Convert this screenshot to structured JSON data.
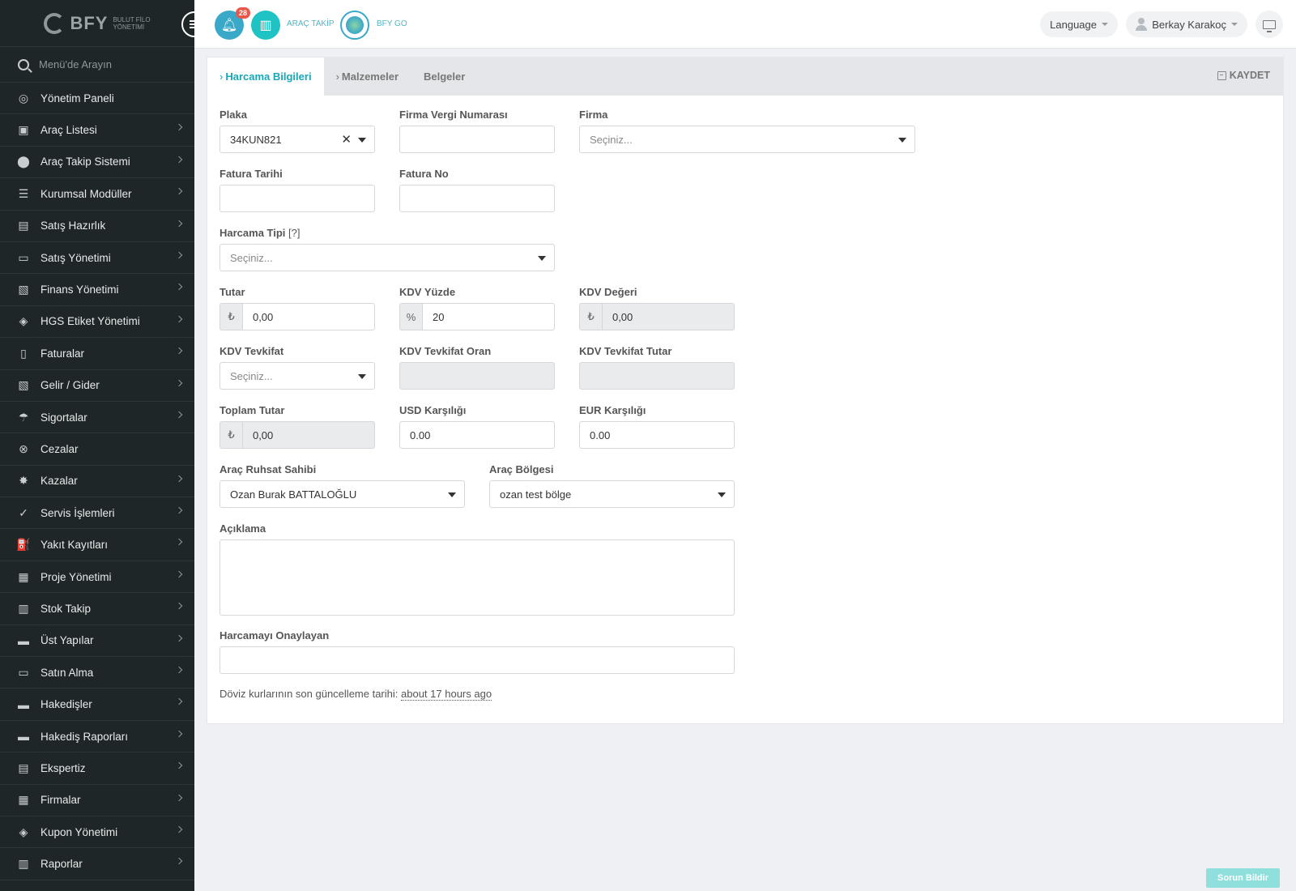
{
  "brand": {
    "name": "BFY",
    "sub_line1": "BULUT FİLO",
    "sub_line2": "YÖNETİMİ"
  },
  "search": {
    "placeholder": "Menü'de Arayın"
  },
  "sidebar": {
    "items": [
      {
        "label": "Yönetim Paneli",
        "icon": "dashboard-icon",
        "glyph": "◎",
        "chevron": false
      },
      {
        "label": "Araç Listesi",
        "icon": "bus-icon",
        "glyph": "▣",
        "chevron": true
      },
      {
        "label": "Araç Takip Sistemi",
        "icon": "map-marker-icon",
        "glyph": "⬤",
        "chevron": true
      },
      {
        "label": "Kurumsal Modüller",
        "icon": "server-icon",
        "glyph": "☰",
        "chevron": true
      },
      {
        "label": "Satış Hazırlık",
        "icon": "book-icon",
        "glyph": "▤",
        "chevron": true
      },
      {
        "label": "Satış Yönetimi",
        "icon": "credit-card-icon",
        "glyph": "▭",
        "chevron": true
      },
      {
        "label": "Finans Yönetimi",
        "icon": "money-icon",
        "glyph": "▧",
        "chevron": true
      },
      {
        "label": "HGS Etiket Yönetimi",
        "icon": "tag-icon",
        "glyph": "◈",
        "chevron": true
      },
      {
        "label": "Faturalar",
        "icon": "file-icon",
        "glyph": "▯",
        "chevron": true
      },
      {
        "label": "Gelir / Gider",
        "icon": "money-icon",
        "glyph": "▧",
        "chevron": true
      },
      {
        "label": "Sigortalar",
        "icon": "umbrella-icon",
        "glyph": "☂",
        "chevron": true
      },
      {
        "label": "Cezalar",
        "icon": "times-circle-icon",
        "glyph": "⊗",
        "chevron": false
      },
      {
        "label": "Kazalar",
        "icon": "car-crash-icon",
        "glyph": "✸",
        "chevron": true
      },
      {
        "label": "Servis İşlemleri",
        "icon": "check-circle-icon",
        "glyph": "✓",
        "chevron": true
      },
      {
        "label": "Yakıt Kayıtları",
        "icon": "gas-pump-icon",
        "glyph": "⛽",
        "chevron": true
      },
      {
        "label": "Proje Yönetimi",
        "icon": "briefcase-icon",
        "glyph": "▦",
        "chevron": true
      },
      {
        "label": "Stok Takip",
        "icon": "inbox-icon",
        "glyph": "▥",
        "chevron": true
      },
      {
        "label": "Üst Yapılar",
        "icon": "truck-icon",
        "glyph": "▬",
        "chevron": true
      },
      {
        "label": "Satın Alma",
        "icon": "credit-card-icon",
        "glyph": "▭",
        "chevron": true
      },
      {
        "label": "Hakedişler",
        "icon": "truck-icon",
        "glyph": "▬",
        "chevron": true
      },
      {
        "label": "Hakediş Raporları",
        "icon": "truck-icon",
        "glyph": "▬",
        "chevron": true
      },
      {
        "label": "Ekspertiz",
        "icon": "clipboard-icon",
        "glyph": "▤",
        "chevron": true
      },
      {
        "label": "Firmalar",
        "icon": "building-icon",
        "glyph": "▦",
        "chevron": true
      },
      {
        "label": "Kupon Yönetimi",
        "icon": "ticket-icon",
        "glyph": "◈",
        "chevron": true
      },
      {
        "label": "Raporlar",
        "icon": "bar-chart-icon",
        "glyph": "▥",
        "chevron": true
      }
    ]
  },
  "topbar": {
    "notification_count": "28",
    "arac_takip": "ARAÇ TAKİP",
    "bfy_go": "BFY GO",
    "language": "Language",
    "user": "Berkay Karakoç"
  },
  "tabs": {
    "harcama": "Harcama Bilgileri",
    "malzemeler": "Malzemeler",
    "belgeler": "Belgeler",
    "save": "KAYDET"
  },
  "form": {
    "plaka": {
      "label": "Plaka",
      "value": "34KUN821"
    },
    "vergi_no": {
      "label": "Firma Vergi Numarası",
      "value": ""
    },
    "firma": {
      "label": "Firma",
      "placeholder": "Seçiniz..."
    },
    "fatura_tarihi": {
      "label": "Fatura Tarihi",
      "value": ""
    },
    "fatura_no": {
      "label": "Fatura No",
      "value": ""
    },
    "harcama_tipi": {
      "label": "Harcama Tipi",
      "help": "[?]",
      "placeholder": "Seçiniz..."
    },
    "tutar": {
      "label": "Tutar",
      "addon": "₺",
      "value": "0,00"
    },
    "kdv_yuzde": {
      "label": "KDV Yüzde",
      "addon": "%",
      "value": "20"
    },
    "kdv_degeri": {
      "label": "KDV Değeri",
      "addon": "₺",
      "value": "0,00"
    },
    "kdv_tevkifat": {
      "label": "KDV Tevkifat",
      "placeholder": "Seçiniz..."
    },
    "kdv_tevkifat_oran": {
      "label": "KDV Tevkifat Oran",
      "value": ""
    },
    "kdv_tevkifat_tutar": {
      "label": "KDV Tevkifat Tutar",
      "value": ""
    },
    "toplam_tutar": {
      "label": "Toplam Tutar",
      "addon": "₺",
      "value": "0,00"
    },
    "usd": {
      "label": "USD Karşılığı",
      "value": "0.00"
    },
    "eur": {
      "label": "EUR Karşılığı",
      "value": "0.00"
    },
    "ruhsat_sahibi": {
      "label": "Araç Ruhsat Sahibi",
      "value": "Ozan Burak BATTALOĞLU"
    },
    "arac_bolgesi": {
      "label": "Araç Bölgesi",
      "value": "ozan test bölge"
    },
    "aciklama": {
      "label": "Açıklama",
      "value": ""
    },
    "onaylayan": {
      "label": "Harcamayı Onaylayan",
      "value": ""
    },
    "note_prefix": "Döviz kurlarının son güncelleme tarihi:",
    "note_time": "about 17 hours ago"
  },
  "report_button": "Sorun Bildir"
}
